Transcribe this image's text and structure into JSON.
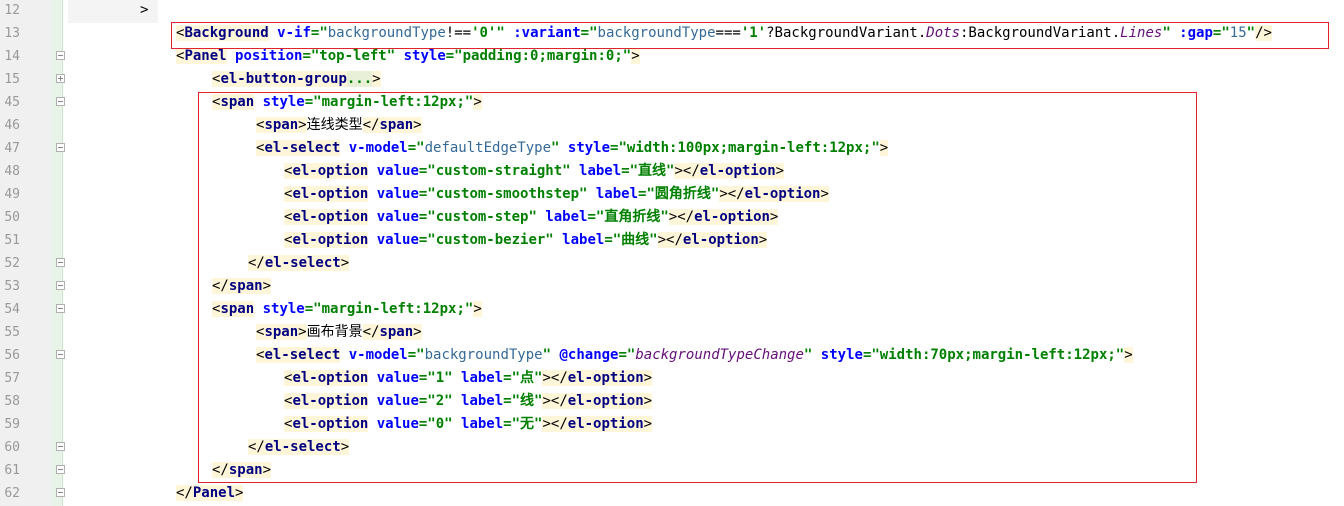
{
  "lines": [
    {
      "num": "12",
      "fold": "",
      "tokens": [
        {
          "t": ">",
          "c": "plain"
        }
      ]
    },
    {
      "num": "13",
      "fold": "",
      "tokens": [
        {
          "t": "<",
          "c": "br"
        },
        {
          "t": "Background",
          "c": "tag"
        },
        {
          "t": " v-if",
          "c": "attr"
        },
        {
          "t": "=\"",
          "c": "str"
        },
        {
          "t": "backgroundType",
          "c": "expr"
        },
        {
          "t": "!==",
          "c": "plain"
        },
        {
          "t": "'0'",
          "c": "str"
        },
        {
          "t": "\"",
          "c": "str"
        },
        {
          "t": " :variant",
          "c": "attr"
        },
        {
          "t": "=\"",
          "c": "str"
        },
        {
          "t": "backgroundType",
          "c": "expr"
        },
        {
          "t": "===",
          "c": "plain"
        },
        {
          "t": "'1'",
          "c": "str"
        },
        {
          "t": "?BackgroundVariant.",
          "c": "plain"
        },
        {
          "t": "Dots",
          "c": "ital"
        },
        {
          "t": ":BackgroundVariant.",
          "c": "plain"
        },
        {
          "t": "Lines",
          "c": "ital"
        },
        {
          "t": "\"",
          "c": "str"
        },
        {
          "t": " :gap",
          "c": "attr"
        },
        {
          "t": "=\"",
          "c": "str"
        },
        {
          "t": "15",
          "c": "expr"
        },
        {
          "t": "\"",
          "c": "str"
        },
        {
          "t": "/>",
          "c": "br"
        }
      ]
    },
    {
      "num": "14",
      "fold": "minus",
      "tokens": [
        {
          "t": "<",
          "c": "br"
        },
        {
          "t": "Panel",
          "c": "tag"
        },
        {
          "t": " position",
          "c": "attr"
        },
        {
          "t": "=\"top-left\"",
          "c": "str"
        },
        {
          "t": " style",
          "c": "attr"
        },
        {
          "t": "=\"padding:0;margin:0;\"",
          "c": "str"
        },
        {
          "t": ">",
          "c": "br"
        }
      ]
    },
    {
      "num": "15",
      "fold": "plus",
      "tokens": [
        {
          "t": "<",
          "c": "br"
        },
        {
          "t": "el-button-group",
          "c": "tag"
        },
        {
          "t": "...",
          "c": "ellip"
        },
        {
          "t": ">",
          "c": "br"
        }
      ]
    },
    {
      "num": "45",
      "fold": "minus",
      "tokens": [
        {
          "t": "<",
          "c": "br"
        },
        {
          "t": "span",
          "c": "tag"
        },
        {
          "t": " style",
          "c": "attr"
        },
        {
          "t": "=\"margin-left:12px;\"",
          "c": "str"
        },
        {
          "t": ">",
          "c": "br"
        }
      ]
    },
    {
      "num": "46",
      "fold": "",
      "tokens": [
        {
          "t": "<",
          "c": "br"
        },
        {
          "t": "span",
          "c": "tag"
        },
        {
          "t": ">",
          "c": "br"
        },
        {
          "t": "连线类型",
          "c": "plain"
        },
        {
          "t": "</",
          "c": "br"
        },
        {
          "t": "span",
          "c": "tag"
        },
        {
          "t": ">",
          "c": "br"
        }
      ]
    },
    {
      "num": "47",
      "fold": "minus",
      "tokens": [
        {
          "t": "<",
          "c": "br"
        },
        {
          "t": "el-select",
          "c": "tag"
        },
        {
          "t": " v-model",
          "c": "attr"
        },
        {
          "t": "=\"",
          "c": "str"
        },
        {
          "t": "defaultEdgeType",
          "c": "expr"
        },
        {
          "t": "\"",
          "c": "str"
        },
        {
          "t": " style",
          "c": "attr"
        },
        {
          "t": "=\"width:100px;margin-left:12px;\"",
          "c": "str"
        },
        {
          "t": ">",
          "c": "br"
        }
      ]
    },
    {
      "num": "48",
      "fold": "",
      "tokens": [
        {
          "t": "<",
          "c": "br"
        },
        {
          "t": "el-option",
          "c": "tag"
        },
        {
          "t": " value",
          "c": "attr"
        },
        {
          "t": "=\"custom-straight\"",
          "c": "str"
        },
        {
          "t": " label",
          "c": "attr"
        },
        {
          "t": "=\"直线\"",
          "c": "str"
        },
        {
          "t": "></",
          "c": "br"
        },
        {
          "t": "el-option",
          "c": "tag"
        },
        {
          "t": ">",
          "c": "br"
        }
      ]
    },
    {
      "num": "49",
      "fold": "",
      "tokens": [
        {
          "t": "<",
          "c": "br"
        },
        {
          "t": "el-option",
          "c": "tag"
        },
        {
          "t": " value",
          "c": "attr"
        },
        {
          "t": "=\"custom-smoothstep\"",
          "c": "str"
        },
        {
          "t": " label",
          "c": "attr"
        },
        {
          "t": "=\"圆角折线\"",
          "c": "str"
        },
        {
          "t": "></",
          "c": "br"
        },
        {
          "t": "el-option",
          "c": "tag"
        },
        {
          "t": ">",
          "c": "br"
        }
      ]
    },
    {
      "num": "50",
      "fold": "",
      "tokens": [
        {
          "t": "<",
          "c": "br"
        },
        {
          "t": "el-option",
          "c": "tag"
        },
        {
          "t": " value",
          "c": "attr"
        },
        {
          "t": "=\"custom-step\"",
          "c": "str"
        },
        {
          "t": " label",
          "c": "attr"
        },
        {
          "t": "=\"直角折线\"",
          "c": "str"
        },
        {
          "t": "></",
          "c": "br"
        },
        {
          "t": "el-option",
          "c": "tag"
        },
        {
          "t": ">",
          "c": "br"
        }
      ]
    },
    {
      "num": "51",
      "fold": "",
      "tokens": [
        {
          "t": "<",
          "c": "br"
        },
        {
          "t": "el-option",
          "c": "tag"
        },
        {
          "t": " value",
          "c": "attr"
        },
        {
          "t": "=\"custom-bezier\"",
          "c": "str"
        },
        {
          "t": " label",
          "c": "attr"
        },
        {
          "t": "=\"曲线\"",
          "c": "str"
        },
        {
          "t": "></",
          "c": "br"
        },
        {
          "t": "el-option",
          "c": "tag"
        },
        {
          "t": ">",
          "c": "br"
        }
      ]
    },
    {
      "num": "52",
      "fold": "minus",
      "tokens": [
        {
          "t": "</",
          "c": "br"
        },
        {
          "t": "el-select",
          "c": "tag"
        },
        {
          "t": ">",
          "c": "br"
        }
      ]
    },
    {
      "num": "53",
      "fold": "minus",
      "tokens": [
        {
          "t": "</",
          "c": "br"
        },
        {
          "t": "span",
          "c": "tag"
        },
        {
          "t": ">",
          "c": "br"
        }
      ]
    },
    {
      "num": "54",
      "fold": "minus",
      "tokens": [
        {
          "t": "<",
          "c": "br"
        },
        {
          "t": "span",
          "c": "tag"
        },
        {
          "t": " style",
          "c": "attr"
        },
        {
          "t": "=\"margin-left:12px;\"",
          "c": "str"
        },
        {
          "t": ">",
          "c": "br"
        }
      ]
    },
    {
      "num": "55",
      "fold": "",
      "tokens": [
        {
          "t": "<",
          "c": "br"
        },
        {
          "t": "span",
          "c": "tag"
        },
        {
          "t": ">",
          "c": "br"
        },
        {
          "t": "画布背景",
          "c": "plain"
        },
        {
          "t": "</",
          "c": "br"
        },
        {
          "t": "span",
          "c": "tag"
        },
        {
          "t": ">",
          "c": "br"
        }
      ]
    },
    {
      "num": "56",
      "fold": "minus",
      "tokens": [
        {
          "t": "<",
          "c": "br"
        },
        {
          "t": "el-select",
          "c": "tag"
        },
        {
          "t": " v-model",
          "c": "attr"
        },
        {
          "t": "=\"",
          "c": "str"
        },
        {
          "t": "backgroundType",
          "c": "expr"
        },
        {
          "t": "\"",
          "c": "str"
        },
        {
          "t": " @change",
          "c": "attr"
        },
        {
          "t": "=\"",
          "c": "str"
        },
        {
          "t": "backgroundTypeChange",
          "c": "ital"
        },
        {
          "t": "\"",
          "c": "str"
        },
        {
          "t": " style",
          "c": "attr"
        },
        {
          "t": "=\"width:70px;margin-left:12px;\"",
          "c": "str"
        },
        {
          "t": ">",
          "c": "br"
        }
      ]
    },
    {
      "num": "57",
      "fold": "",
      "tokens": [
        {
          "t": "<",
          "c": "br"
        },
        {
          "t": "el-option",
          "c": "tag"
        },
        {
          "t": " value",
          "c": "attr"
        },
        {
          "t": "=\"1\"",
          "c": "str"
        },
        {
          "t": " label",
          "c": "attr"
        },
        {
          "t": "=\"点\"",
          "c": "str"
        },
        {
          "t": "></",
          "c": "br"
        },
        {
          "t": "el-option",
          "c": "tag"
        },
        {
          "t": ">",
          "c": "br"
        }
      ]
    },
    {
      "num": "58",
      "fold": "",
      "tokens": [
        {
          "t": "<",
          "c": "br"
        },
        {
          "t": "el-option",
          "c": "tag"
        },
        {
          "t": " value",
          "c": "attr"
        },
        {
          "t": "=\"2\"",
          "c": "str"
        },
        {
          "t": " label",
          "c": "attr"
        },
        {
          "t": "=\"线\"",
          "c": "str"
        },
        {
          "t": "></",
          "c": "br"
        },
        {
          "t": "el-option",
          "c": "tag"
        },
        {
          "t": ">",
          "c": "br"
        }
      ]
    },
    {
      "num": "59",
      "fold": "",
      "tokens": [
        {
          "t": "<",
          "c": "br"
        },
        {
          "t": "el-option",
          "c": "tag"
        },
        {
          "t": " value",
          "c": "attr"
        },
        {
          "t": "=\"0\"",
          "c": "str"
        },
        {
          "t": " label",
          "c": "attr"
        },
        {
          "t": "=\"无\"",
          "c": "str"
        },
        {
          "t": "></",
          "c": "br"
        },
        {
          "t": "el-option",
          "c": "tag"
        },
        {
          "t": ">",
          "c": "br"
        }
      ]
    },
    {
      "num": "60",
      "fold": "minus",
      "tokens": [
        {
          "t": "</",
          "c": "br"
        },
        {
          "t": "el-select",
          "c": "tag"
        },
        {
          "t": ">",
          "c": "br"
        }
      ]
    },
    {
      "num": "61",
      "fold": "minus",
      "tokens": [
        {
          "t": "</",
          "c": "br"
        },
        {
          "t": "span",
          "c": "tag"
        },
        {
          "t": ">",
          "c": "br"
        }
      ]
    },
    {
      "num": "62",
      "fold": "minus",
      "tokens": [
        {
          "t": "</",
          "c": "br"
        },
        {
          "t": "Panel",
          "c": "tag"
        },
        {
          "t": ">",
          "c": "br"
        }
      ]
    }
  ]
}
